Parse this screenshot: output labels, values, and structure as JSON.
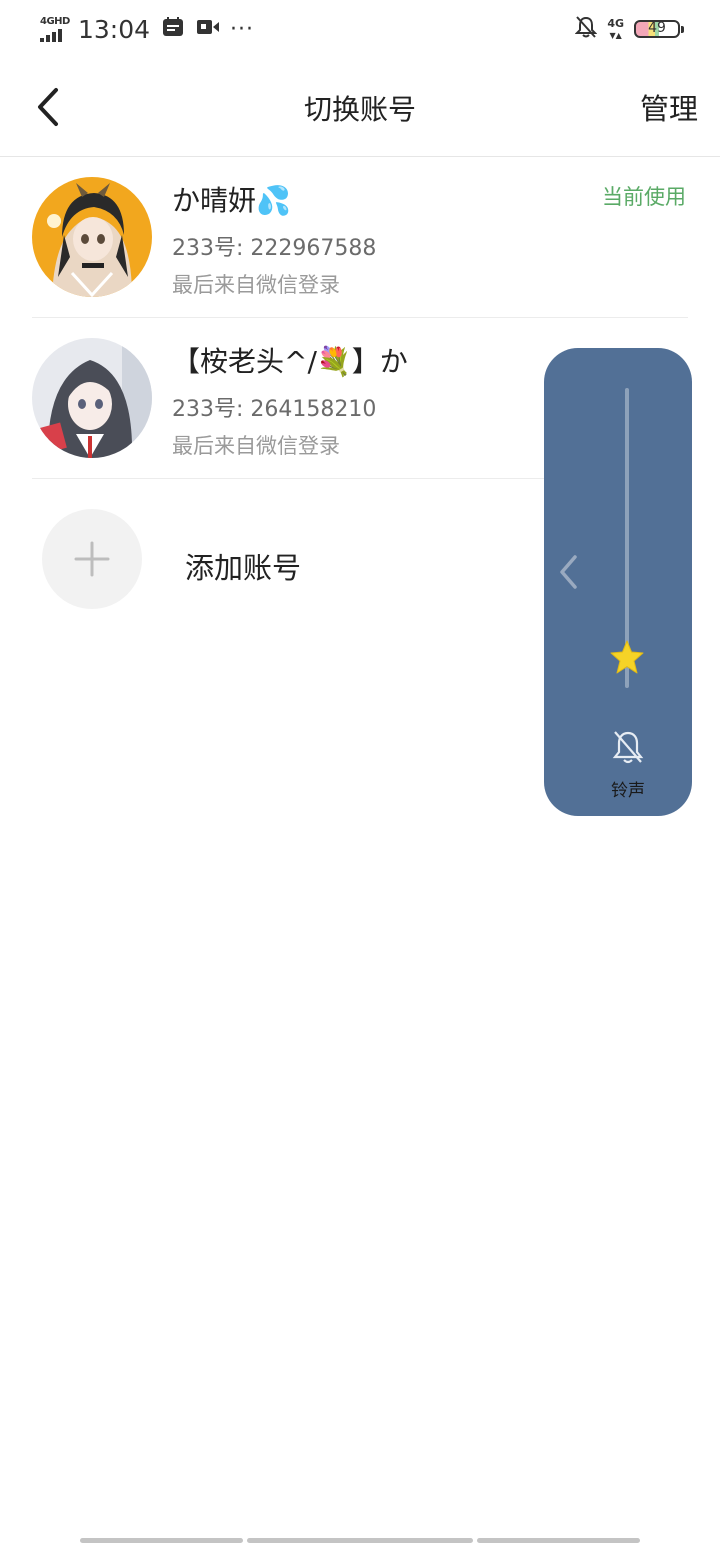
{
  "status_bar": {
    "network_left": "4GHD",
    "time": "13:04",
    "more": "···",
    "network_right": "4G",
    "battery": "49"
  },
  "header": {
    "title": "切换账号",
    "manage_label": "管理"
  },
  "accounts": [
    {
      "name": "か晴妍💦",
      "id_text": "233号: 222967588",
      "source": "最后来自微信登录",
      "status": "当前使用"
    },
    {
      "name": "【桉老头^/💐】か",
      "id_text": "233号: 264158210",
      "source": "最后来自微信登录"
    }
  ],
  "add_account": {
    "label": "添加账号"
  },
  "volume_panel": {
    "label": "铃声",
    "level": 0.1
  },
  "colors": {
    "accent_green": "#5aaa66",
    "panel_blue": "#527096",
    "thumb_yellow": "#f5d327"
  }
}
